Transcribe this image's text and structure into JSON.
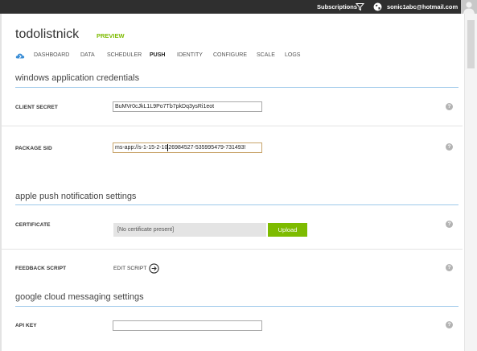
{
  "topbar": {
    "subscriptions": "Subscriptions",
    "filter_icon": "filter-icon",
    "globe_icon": "globe-icon",
    "user_email": "sonic1abc@hotmail.com"
  },
  "header": {
    "app_name": "todolistnick",
    "badge": "PREVIEW"
  },
  "nav": {
    "icon": "cloud-icon",
    "items": [
      {
        "label": "DASHBOARD",
        "active": false
      },
      {
        "label": "DATA",
        "active": false
      },
      {
        "label": "SCHEDULER",
        "active": false
      },
      {
        "label": "PUSH",
        "active": true
      },
      {
        "label": "IDENTITY",
        "active": false
      },
      {
        "label": "CONFIGURE",
        "active": false
      },
      {
        "label": "SCALE",
        "active": false
      },
      {
        "label": "LOGS",
        "active": false
      }
    ]
  },
  "windows": {
    "title": "windows application credentials",
    "client_secret_label": "CLIENT SECRET",
    "client_secret_value": "BuMVr0cJkL1L9Po7Tb7pkDq3ysRi1eot",
    "package_sid_label": "PACKAGE SID",
    "package_sid_value_before_caret": "ms-app://s-1-15-2-10",
    "package_sid_value_after_caret": "26984527-535995479-731493!"
  },
  "apple": {
    "title": "apple push notification settings",
    "certificate_label": "CERTIFICATE",
    "certificate_status": "[No certificate present]",
    "upload_label": "Upload",
    "feedback_label": "FEEDBACK SCRIPT",
    "edit_script_label": "EDIT SCRIPT"
  },
  "google": {
    "title": "google cloud messaging settings",
    "api_key_label": "API KEY",
    "api_key_value": ""
  },
  "help_glyph": "?",
  "colors": {
    "accent_green": "#7dbb00",
    "topbar_bg": "#2f2f2f",
    "section_rule": "#9ec9ea"
  }
}
